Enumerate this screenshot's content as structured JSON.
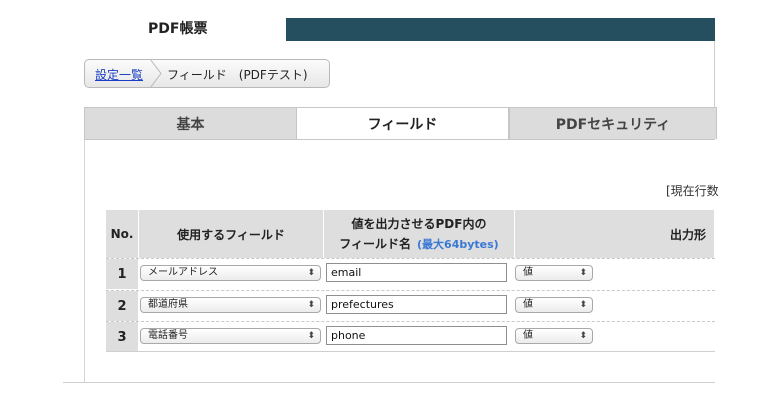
{
  "header": {
    "title": "PDF帳票"
  },
  "breadcrumb": {
    "link": "設定一覧",
    "current": "フィールド　(PDFテスト)"
  },
  "tabs": [
    {
      "label": "基本",
      "active": false
    },
    {
      "label": "フィールド",
      "active": true
    },
    {
      "label": "PDFセキュリティ",
      "active": false
    }
  ],
  "row_count_label": "[現在行数",
  "table": {
    "headers": {
      "no": "No.",
      "field": "使用するフィールド",
      "pdf_field_line1": "値を出力させるPDF内の",
      "pdf_field_line2": "フィールド名",
      "pdf_field_hint": "(最大64bytes)",
      "output": "出力形"
    },
    "rows": [
      {
        "no": "1",
        "field": "メールアドレス",
        "pdf_field": "email",
        "output": "値"
      },
      {
        "no": "2",
        "field": "都道府県",
        "pdf_field": "prefectures",
        "output": "値"
      },
      {
        "no": "3",
        "field": "電話番号",
        "pdf_field": "phone",
        "output": "値"
      }
    ]
  },
  "colors": {
    "header_bar": "#254f5e",
    "link": "#1a3fc4",
    "hint": "#3a78d6",
    "table_header": "#dedede"
  },
  "icons": {
    "select_arrows": "updown-arrows-icon"
  }
}
